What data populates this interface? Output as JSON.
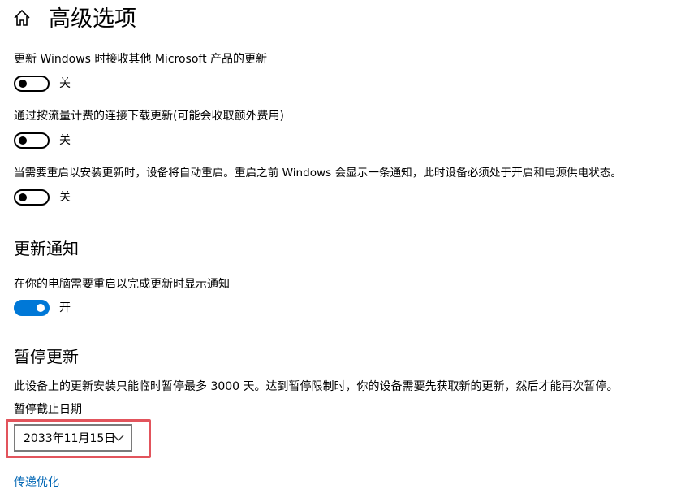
{
  "header": {
    "title": "高级选项",
    "home_icon": "home-icon"
  },
  "options": [
    {
      "label": "更新 Windows 时接收其他 Microsoft 产品的更新",
      "state": "关",
      "on": false
    },
    {
      "label": "通过按流量计费的连接下载更新(可能会收取额外费用)",
      "state": "关",
      "on": false
    },
    {
      "label": "当需要重启以安装更新时，设备将自动重启。重启之前 Windows 会显示一条通知，此时设备必须处于开启和电源供电状态。",
      "state": "关",
      "on": false
    }
  ],
  "notifications": {
    "heading": "更新通知",
    "label": "在你的电脑需要重启以完成更新时显示通知",
    "state": "开",
    "on": true
  },
  "pause": {
    "heading": "暂停更新",
    "description": "此设备上的更新安装只能临时暂停最多 3000 天。达到暂停限制时，你的设备需要先获取新的更新，然后才能再次暂停。",
    "date_label": "暂停截止日期",
    "date_value": "2033年11月15日",
    "chevron_icon": "chevron-down-icon"
  },
  "links": {
    "delivery_optimization": "传递优化"
  },
  "colors": {
    "accent": "#0078d7",
    "link": "#0066b4",
    "highlight": "#e2545c",
    "toggle_off": "#000000"
  }
}
